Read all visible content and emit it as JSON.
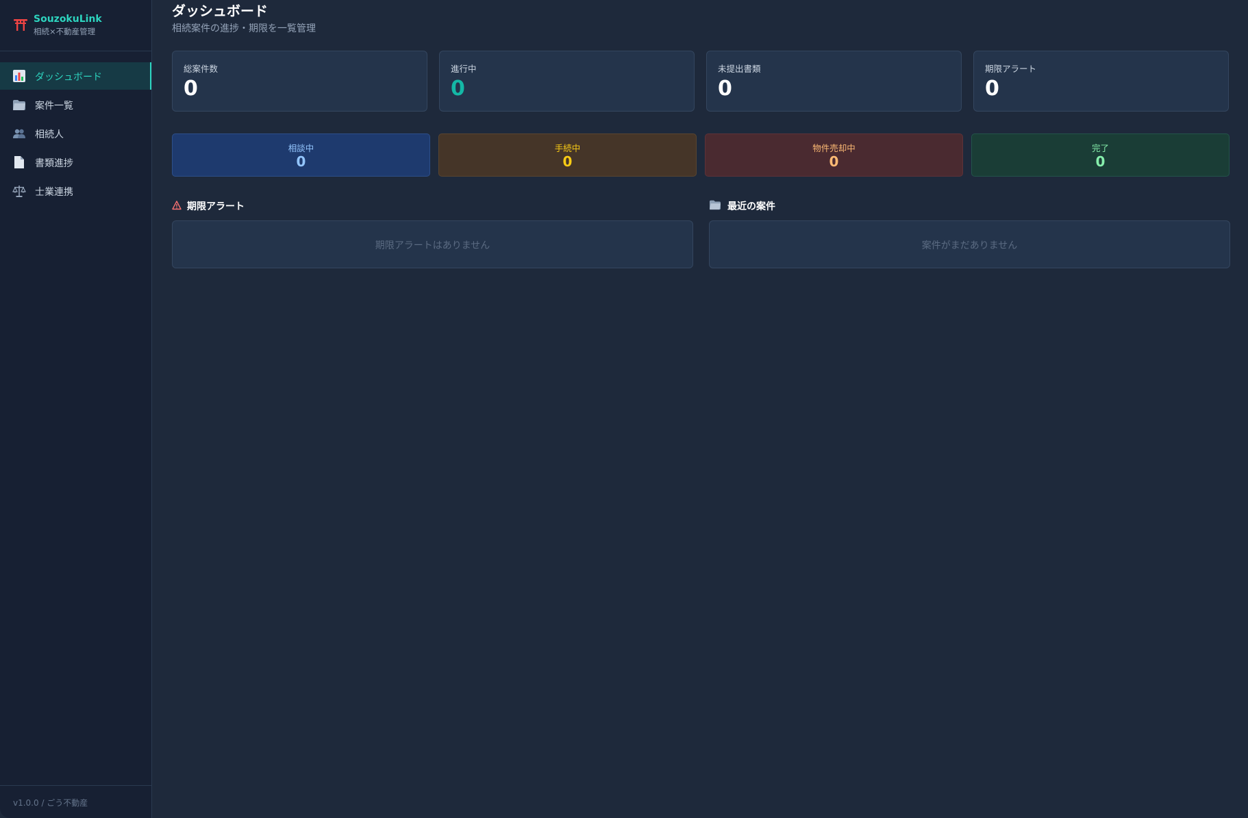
{
  "brand": {
    "name": "SouzokuLink",
    "subtitle": "相続×不動産管理",
    "icon": "torii-gate-icon"
  },
  "sidebar": {
    "items": [
      {
        "label": "ダッシュボード",
        "icon": "bar-chart-icon",
        "active": true
      },
      {
        "label": "案件一覧",
        "icon": "folder-icon",
        "active": false
      },
      {
        "label": "相続人",
        "icon": "people-icon",
        "active": false
      },
      {
        "label": "書類進捗",
        "icon": "document-icon",
        "active": false
      },
      {
        "label": "士業連携",
        "icon": "scales-icon",
        "active": false
      }
    ],
    "footer": "v1.0.0 / ごう不動産"
  },
  "header": {
    "title": "ダッシュボード",
    "subtitle": "相続案件の進捗・期限を一覧管理"
  },
  "stats": [
    {
      "label": "総案件数",
      "value": "0"
    },
    {
      "label": "進行中",
      "value": "0"
    },
    {
      "label": "未提出書類",
      "value": "0"
    },
    {
      "label": "期限アラート",
      "value": "0"
    }
  ],
  "statuses": [
    {
      "label": "相談中",
      "value": "0",
      "color": "#93c5fd"
    },
    {
      "label": "手続中",
      "value": "0",
      "color": "#facc15"
    },
    {
      "label": "物件売却中",
      "value": "0",
      "color": "#fdba74"
    },
    {
      "label": "完了",
      "value": "0",
      "color": "#86efac"
    }
  ],
  "sections": {
    "alerts": {
      "title": "期限アラート",
      "icon": "warning-icon",
      "empty": "期限アラートはありません"
    },
    "recent": {
      "title": "最近の案件",
      "icon": "folder-icon",
      "empty": "案件がまだありません"
    }
  },
  "colors": {
    "accent": "#2dd4bf",
    "background": "#1e293b",
    "sidebar": "#172033",
    "card": "#24344b"
  }
}
